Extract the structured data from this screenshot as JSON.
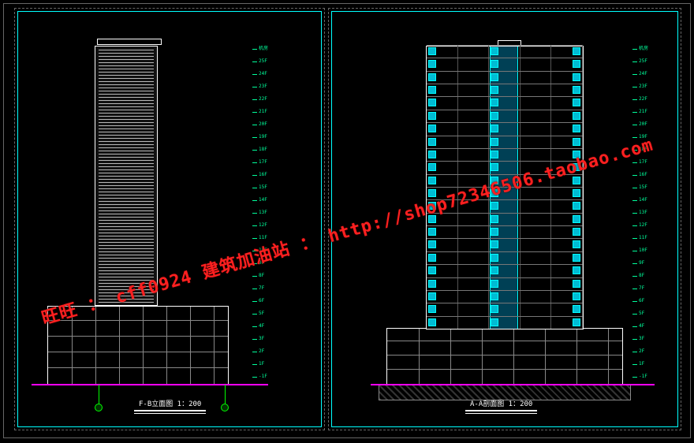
{
  "watermark": "旺旺 ： cff0924  建筑加油站 ： http://shop72346506.taobao.com",
  "left_drawing": {
    "title": "F-B立面图 1：200"
  },
  "right_drawing": {
    "title": "A-A剖面图 1：200"
  },
  "floor_labels": [
    "-1F",
    "1F",
    "2F",
    "3F",
    "4F",
    "5F",
    "6F",
    "7F",
    "8F",
    "9F",
    "10F",
    "11F",
    "12F",
    "13F",
    "14F",
    "15F",
    "16F",
    "17F",
    "18F",
    "19F",
    "20F",
    "21F",
    "22F",
    "23F",
    "24F",
    "25F",
    "机房"
  ],
  "chart_data": {
    "type": "diagram",
    "description": "Two architectural CAD drawings of a 25-storey high-rise building with machine-room level on top and podium at bottom. Left: exterior elevation (F-B). Right: cross-section (A-A). Scale 1:200.",
    "building": {
      "storeys_above_ground": 25,
      "basement_levels": 1,
      "roof_machine_room": true,
      "podium_storeys": 4,
      "scale": "1:200"
    }
  }
}
